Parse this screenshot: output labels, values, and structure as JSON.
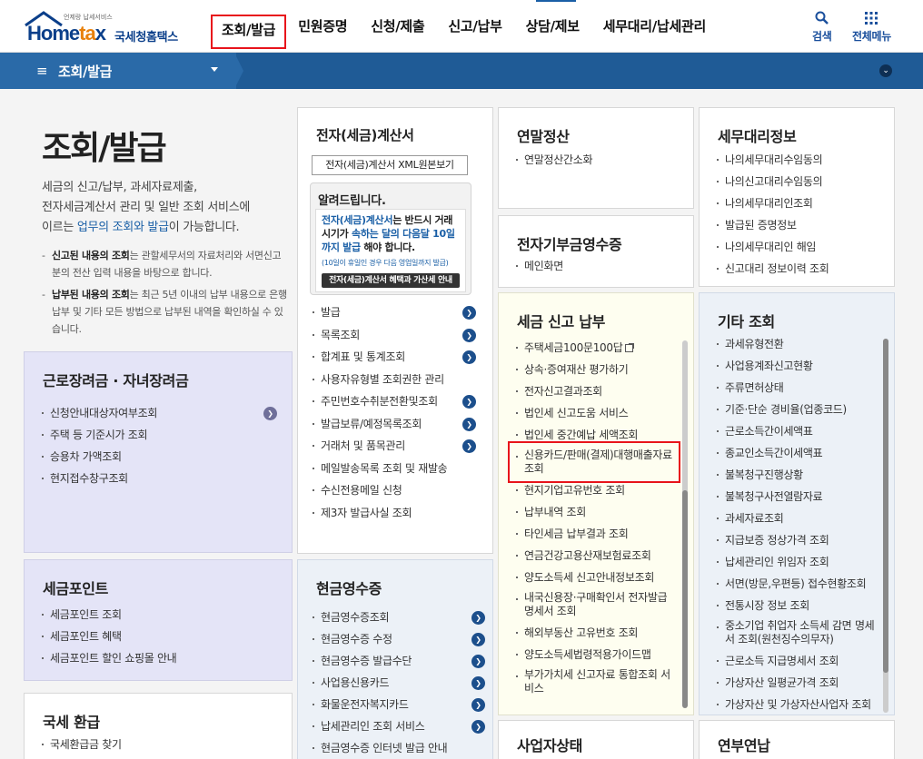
{
  "header": {
    "logo_small": "언제랑 납세서비스",
    "logo_home": "Home",
    "logo_ta": "ta",
    "logo_x": "x",
    "logo_sub": "국세청홈택스",
    "nav": [
      "조회/발급",
      "민원증명",
      "신청/제출",
      "신고/납부",
      "상담/제보",
      "세무대리/납세관리"
    ],
    "search_label": "검색",
    "allmenu_label": "전체메뉴"
  },
  "subbar": {
    "title": "조회/발급"
  },
  "hero": {
    "title": "조회/발급",
    "desc_1": "세금의 신고/납부, 과세자료제출,",
    "desc_2": "전자세금계산서 관리 및 일반 조회 서비스에",
    "desc_3a": "이르는 ",
    "desc_3b": "업무의 조회와 발급",
    "desc_3c": "이 가능합니다.",
    "note1_b": "신고된 내용의 조회",
    "note1_t": "는 관할세무서의 자료처리와 서면신고분의 전산 입력 내용을 바탕으로 합니다.",
    "note2_b": "납부된 내용의 조회",
    "note2_t": "는 최근 5년 이내의 납부 내용으로 은행 납부 및 기타 모든 방법으로 납부된 내역을 확인하실 수 있습니다."
  },
  "panels": {
    "earned": {
      "title": "근로장려금 · 자녀장려금",
      "items": [
        "신청안내대상자여부조회",
        "주택 등 기준시가 조회",
        "승용차 가액조회",
        "현지접수창구조회"
      ]
    },
    "point": {
      "title": "세금포인트",
      "items": [
        "세금포인트 조회",
        "세금포인트 혜택",
        "세금포인트 할인 쇼핑몰 안내"
      ]
    },
    "refund": {
      "title": "국세 환급",
      "items": [
        "국세환급금 찾기"
      ]
    },
    "einvoice": {
      "title": "전자(세금)계산서",
      "xml_button": "전자(세금)계산서 XML원본보기",
      "notice_title": "알려드립니다.",
      "notice_1": "전자(세금)계산서",
      "notice_2": "는 반드시 거래시기가 ",
      "notice_3": "속하는 달의 다음달 10일까지 발급",
      "notice_4": " 해야 합니다.",
      "notice_small": "(10일이 휴일인 경우 다음 영업일까지 발급)",
      "notice_button": "전자(세금)계산서 혜택과 가산세 안내",
      "items": [
        "발급",
        "목록조회",
        "합계표 및 통계조회",
        "사용자유형별 조회권한 관리",
        "주민번호수취분전환및조회",
        "발급보류/예정목록조회",
        "거래처 및 품목관리",
        "메일발송목록 조회 및 재발송",
        "수신전용메일 신청",
        "제3자 발급사실 조회"
      ]
    },
    "cashreceipt": {
      "title": "현금영수증",
      "items": [
        "현금영수증조회",
        "현금영수증 수정",
        "현금영수증 발급수단",
        "사업용신용카드",
        "화물운전자복지카드",
        "납세관리인 조회 서비스",
        "현금영수증 인터넷 발급 안내"
      ]
    },
    "yearend": {
      "title": "연말정산",
      "items": [
        "연말정산간소화"
      ]
    },
    "donation": {
      "title": "전자기부금영수증",
      "items": [
        "메인화면"
      ]
    },
    "taxreport": {
      "title": "세금 신고 납부",
      "items": [
        "주택세금100문100답",
        "상속·증여재산 평가하기",
        "전자신고결과조회",
        "법인세 신고도움 서비스",
        "법인세 중간예납 세액조회",
        "신용카드/판매(결제)대행매출자료조회",
        "현지기업고유번호 조회",
        "납부내역 조회",
        "타인세금 납부결과 조회",
        "연금건강고용산재보험료조회",
        "양도소득세 신고안내정보조회",
        "내국신용장·구매확인서 전자발급명세서 조회",
        "해외부동산 고유번호 조회",
        "양도소득세법령적용가이드맵",
        "부가가치세 신고자료 통합조회 서비스"
      ]
    },
    "bizstatus": {
      "title": "사업자상태"
    },
    "agent": {
      "title": "세무대리정보",
      "items": [
        "나의세무대리수임동의",
        "나의신고대리수임동의",
        "나의세무대리인조회",
        "발급된 증명정보",
        "나의세무대리인 해임",
        "신고대리 정보이력 조회"
      ]
    },
    "etc": {
      "title": "기타 조회",
      "items": [
        "과세유형전환",
        "사업용계좌신고현황",
        "주류면허상태",
        "기준·단순 경비율(업종코드)",
        "근로소득간이세액표",
        "종교인소득간이세액표",
        "불복청구진행상황",
        "불복청구사전열람자료",
        "과세자료조회",
        "지급보증 정상가격 조회",
        "납세관리인 위임자 조회",
        "서면(방문,우편등) 접수현황조회",
        "전통시장 정보 조회",
        "중소기업 취업자 소득세 감면 명세서 조회(원천징수의무자)",
        "근로소득 지급명세서 조회",
        "가상자산 일평균가격 조회",
        "가상자산 및 가상자산사업자 조회"
      ]
    },
    "pension": {
      "title": "연부연납"
    }
  }
}
